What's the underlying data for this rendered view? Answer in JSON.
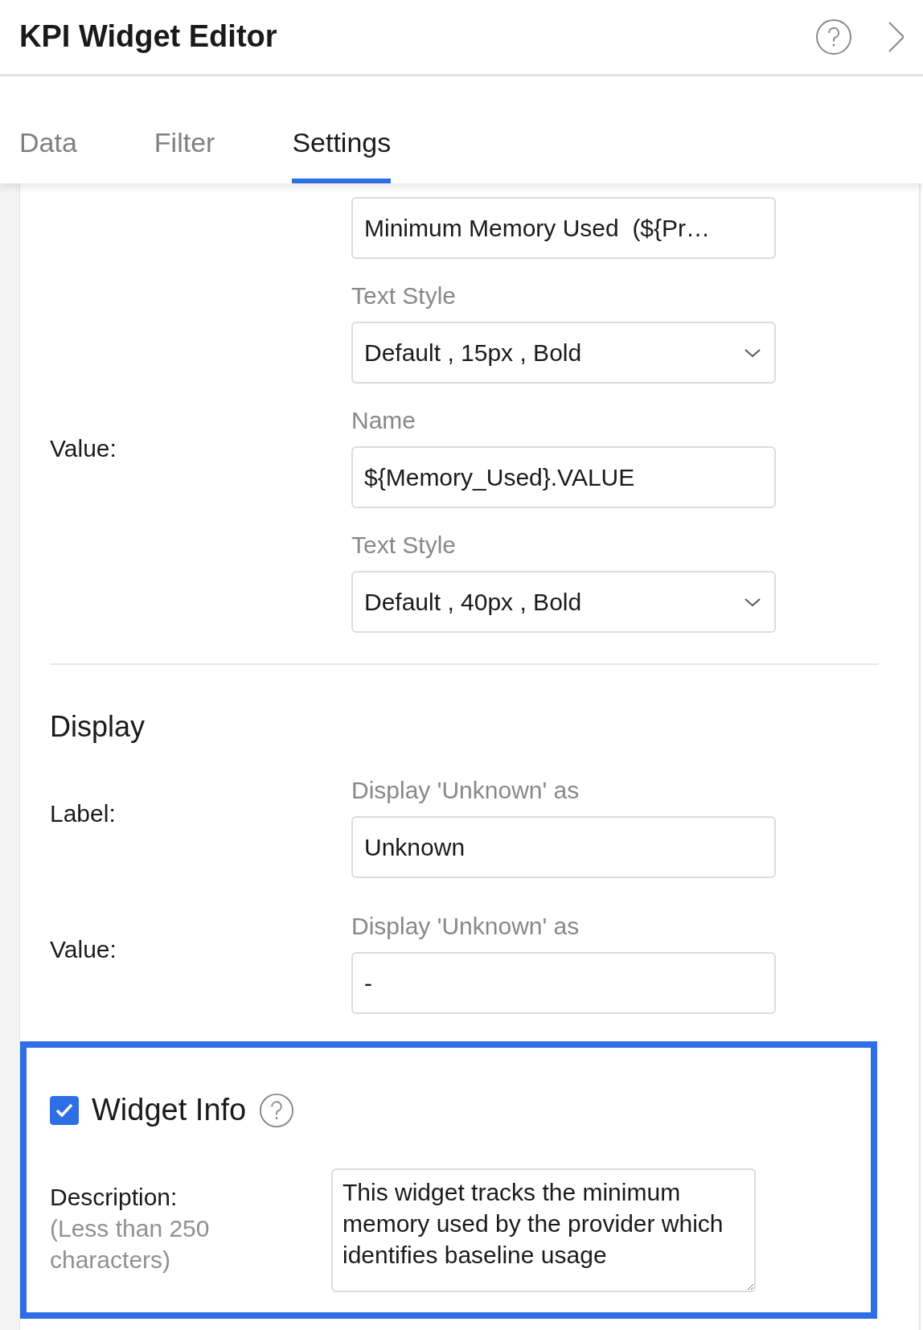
{
  "header": {
    "title": "KPI Widget Editor"
  },
  "tabs": [
    {
      "label": "Data",
      "selected": false
    },
    {
      "label": "Filter",
      "selected": false
    },
    {
      "label": "Settings",
      "selected": true
    }
  ],
  "value_section": {
    "label": "Value:",
    "fields": [
      {
        "kind": "input",
        "value": "Minimum Memory Used  (${Pr…"
      },
      {
        "kind": "select",
        "caption": "Text Style",
        "value": "Default , 15px , Bold"
      },
      {
        "kind": "input",
        "caption": "Name",
        "value": "${Memory_Used}.VALUE"
      },
      {
        "kind": "select",
        "caption": "Text Style",
        "value": "Default , 40px , Bold"
      }
    ]
  },
  "display": {
    "heading": "Display",
    "rows": [
      {
        "label": "Label:",
        "caption": "Display 'Unknown' as",
        "value": "Unknown"
      },
      {
        "label": "Value:",
        "caption": "Display 'Unknown' as",
        "value": "-"
      }
    ]
  },
  "widget_info": {
    "checked": true,
    "title": "Widget Info",
    "description_label": "Description:",
    "description_hint": "(Less than 250 characters)",
    "description": "This widget tracks the minimum memory used by the provider which identifies baseline usage"
  }
}
